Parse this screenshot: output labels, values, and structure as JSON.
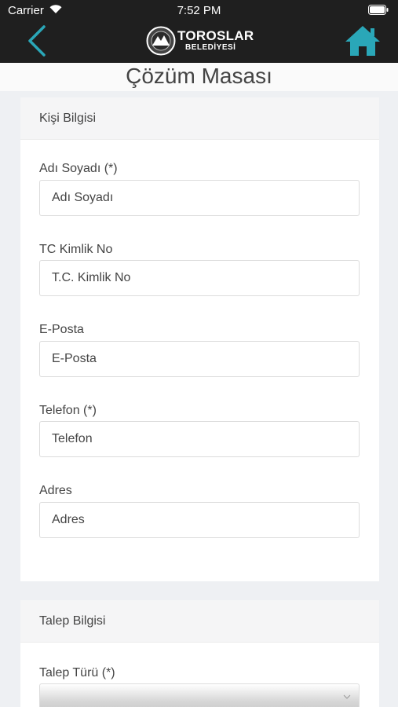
{
  "status_bar": {
    "carrier": "Carrier",
    "time": "7:52 PM"
  },
  "header": {
    "logo_line1": "TOROSLAR",
    "logo_line2": "BELEDİYESİ",
    "accent_color": "#2aa7b8"
  },
  "page": {
    "title": "Çözüm Masası"
  },
  "personal_section": {
    "title": "Kişi Bilgisi",
    "fields": [
      {
        "label": "Adı Soyadı (*)",
        "placeholder": "Adı Soyadı"
      },
      {
        "label": "TC Kimlik No",
        "placeholder": "T.C. Kimlik No"
      },
      {
        "label": "E-Posta",
        "placeholder": "E-Posta"
      },
      {
        "label": "Telefon (*)",
        "placeholder": "Telefon"
      },
      {
        "label": "Adres",
        "placeholder": "Adres"
      }
    ]
  },
  "request_section": {
    "title": "Talep Bilgisi",
    "type_label": "Talep Türü (*)"
  }
}
